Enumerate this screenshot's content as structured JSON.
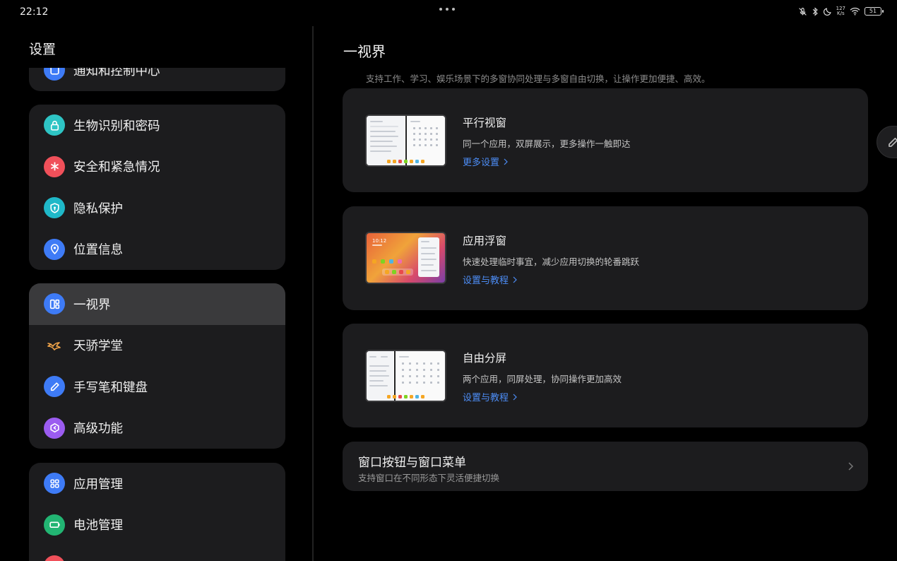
{
  "status_bar": {
    "time": "22:12",
    "net_speed_top": "127",
    "net_speed_bottom": "K/s",
    "battery": "51"
  },
  "left": {
    "title": "设置",
    "groups": [
      {
        "items": [
          {
            "label": "通知和控制中心",
            "icon": "notification-icon",
            "color": "#3e7bf6"
          }
        ]
      },
      {
        "items": [
          {
            "label": "生物识别和密码",
            "icon": "lock-icon",
            "color": "#2ec4c4"
          },
          {
            "label": "安全和紧急情况",
            "icon": "asterisk-icon",
            "color": "#f0505a"
          },
          {
            "label": "隐私保护",
            "icon": "privacy-shield-icon",
            "color": "#1fb8c8"
          },
          {
            "label": "位置信息",
            "icon": "location-pin-icon",
            "color": "#3e7bf6"
          }
        ]
      },
      {
        "items": [
          {
            "label": "一视界",
            "icon": "multiwindow-icon",
            "color": "#3e7bf6",
            "selected": true
          },
          {
            "label": "天骄学堂",
            "icon": "bird-logo-icon",
            "color": "#f2a54a"
          },
          {
            "label": "手写笔和键盘",
            "icon": "pen-icon",
            "color": "#3e7bf6"
          },
          {
            "label": "高级功能",
            "icon": "advanced-icon",
            "color": "#9b5cf0"
          }
        ]
      },
      {
        "items": [
          {
            "label": "应用管理",
            "icon": "apps-grid-icon",
            "color": "#3e7bf6"
          },
          {
            "label": "电池管理",
            "icon": "battery-icon",
            "color": "#22b573"
          },
          {
            "label": "",
            "icon": "partial-icon",
            "color": "#f0505a"
          }
        ]
      }
    ]
  },
  "right": {
    "title": "一视界",
    "description": "支持工作、学习、娱乐场景下的多窗协同处理与多窗自由切换，让操作更加便捷、高效。",
    "cards": [
      {
        "title": "平行视窗",
        "desc": "同一个应用，双屏展示，更多操作一触即达",
        "link": "更多设置"
      },
      {
        "title": "应用浮窗",
        "desc": "快速处理临时事宜，减少应用切换的轮番跳跃",
        "link": "设置与教程"
      },
      {
        "title": "自由分屏",
        "desc": "两个应用，同屏处理，协同操作更加高效",
        "link": "设置与教程"
      }
    ],
    "row": {
      "title": "窗口按钮与窗口菜单",
      "subtitle": "支持窗口在不同形态下灵活便捷切换"
    },
    "float_thumb_time": "10:12"
  },
  "accent_color": "#4d8df6"
}
